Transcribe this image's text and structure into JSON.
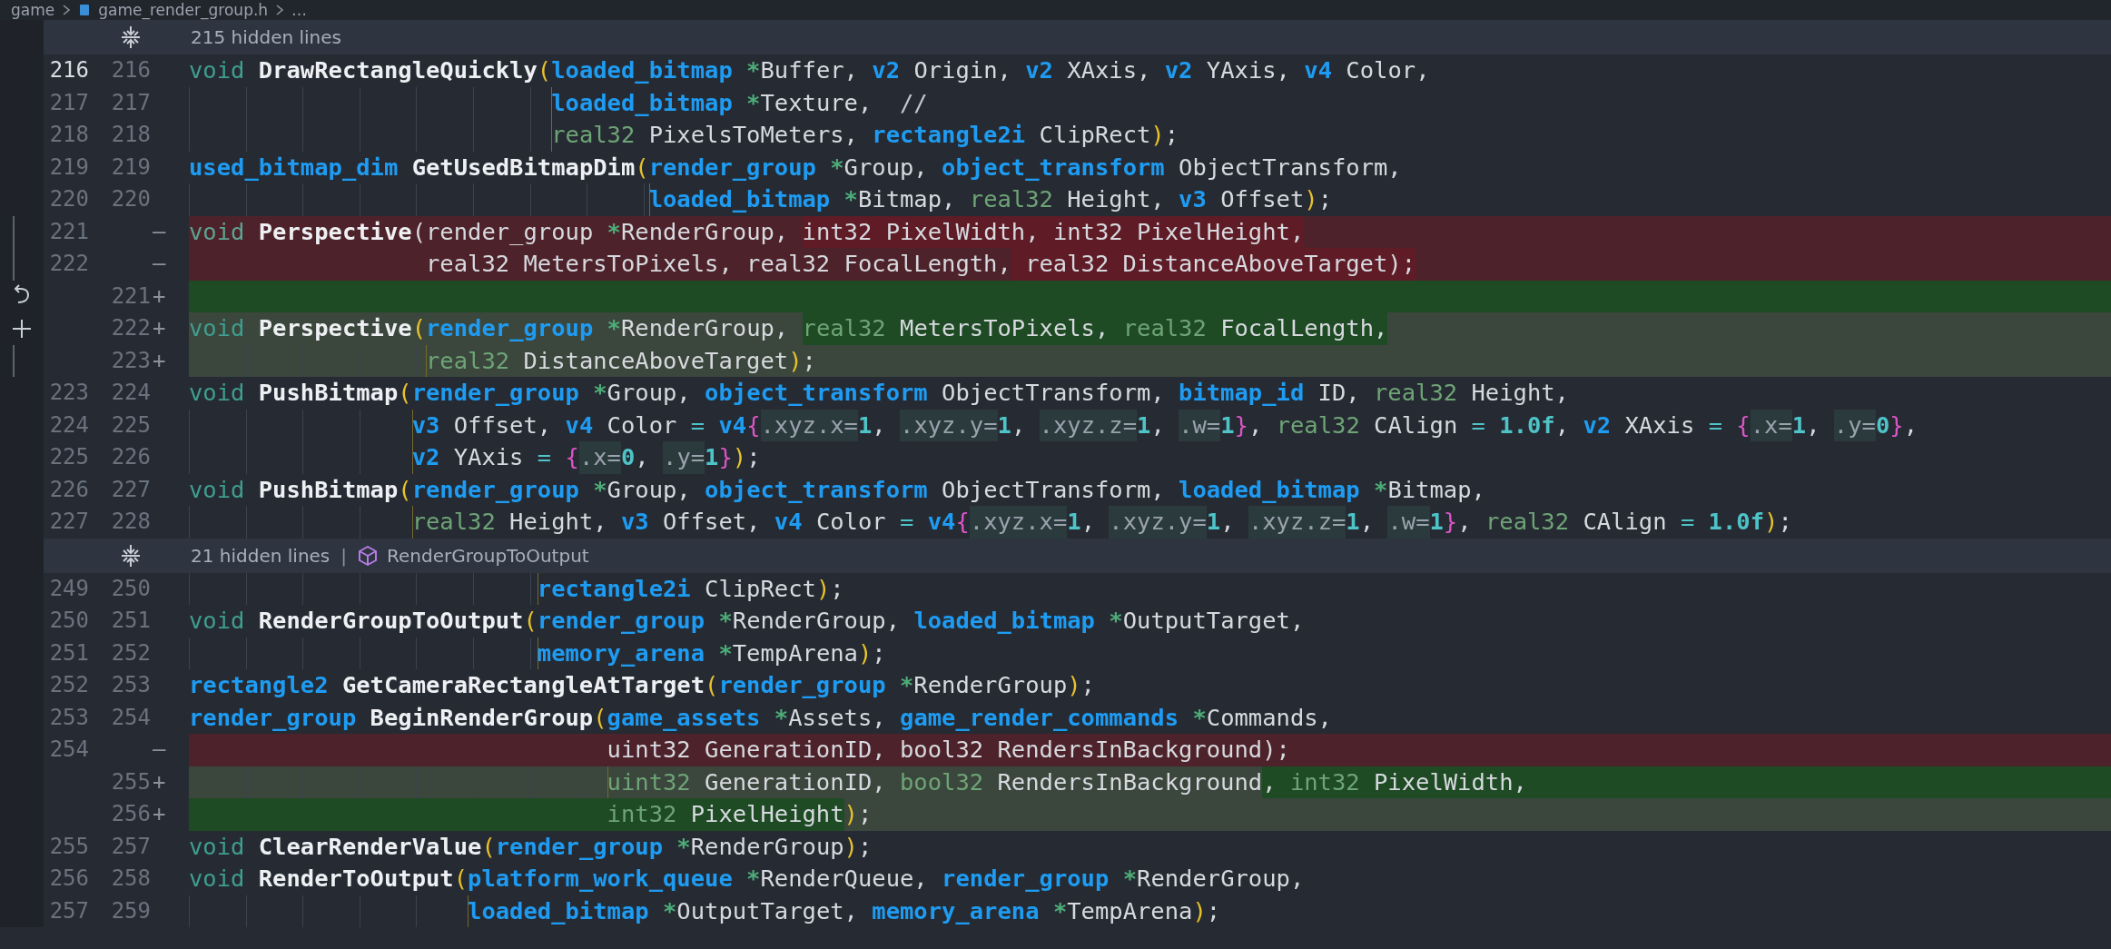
{
  "breadcrumb": [
    {
      "label": "game",
      "kind": "folder"
    },
    {
      "label": "game_render_group.h",
      "kind": "file"
    },
    {
      "label": "…",
      "kind": "more"
    }
  ],
  "sections": [
    {
      "kind": "hidden",
      "label": "215 hidden lines"
    },
    {
      "kind": "lines",
      "rows": [
        {
          "old": "216",
          "new": "216",
          "kind": "context",
          "current": true,
          "tokens": [
            {
              "kind": "kw",
              "text": "void "
            },
            {
              "kind": "fn",
              "text": "DrawRectangleQuickly"
            },
            {
              "kind": "paren",
              "text": "("
            },
            {
              "kind": "type",
              "text": "loaded_bitmap"
            },
            {
              "kind": "star",
              "text": " *"
            },
            {
              "kind": "id",
              "text": "Buffer, "
            },
            {
              "kind": "type",
              "text": "v2"
            },
            {
              "kind": "id",
              "text": " Origin, "
            },
            {
              "kind": "type",
              "text": "v2"
            },
            {
              "kind": "id",
              "text": " XAxis, "
            },
            {
              "kind": "type",
              "text": "v2"
            },
            {
              "kind": "id",
              "text": " YAxis, "
            },
            {
              "kind": "type",
              "text": "v4"
            },
            {
              "kind": "id",
              "text": " Color,"
            }
          ]
        },
        {
          "old": "217",
          "new": "217",
          "kind": "context",
          "current": false,
          "tokens": [
            {
              "kind": "type",
              "text": "                          loaded_bitmap"
            },
            {
              "kind": "star",
              "text": " *"
            },
            {
              "kind": "id",
              "text": "Texture,  "
            },
            {
              "kind": "com",
              "text": "//"
            }
          ]
        },
        {
          "old": "218",
          "new": "218",
          "kind": "context",
          "current": false,
          "tokens": [
            {
              "kind": "prim",
              "text": "                          real32"
            },
            {
              "kind": "id",
              "text": " PixelsToMeters, "
            },
            {
              "kind": "type",
              "text": "rectangle2i"
            },
            {
              "kind": "id",
              "text": " ClipRect"
            },
            {
              "kind": "paren",
              "text": ")"
            },
            {
              "kind": "id",
              "text": ";"
            }
          ]
        },
        {
          "old": "219",
          "new": "219",
          "kind": "context",
          "current": false,
          "tokens": [
            {
              "kind": "type",
              "text": "used_bitmap_dim"
            },
            {
              "kind": "fn",
              "text": " GetUsedBitmapDim"
            },
            {
              "kind": "paren",
              "text": "("
            },
            {
              "kind": "type",
              "text": "render_group"
            },
            {
              "kind": "star",
              "text": " *"
            },
            {
              "kind": "id",
              "text": "Group, "
            },
            {
              "kind": "type",
              "text": "object_transform"
            },
            {
              "kind": "id",
              "text": " ObjectTransform,"
            }
          ]
        },
        {
          "old": "220",
          "new": "220",
          "kind": "context",
          "current": false,
          "tokens": [
            {
              "kind": "type",
              "text": "                                 loaded_bitmap"
            },
            {
              "kind": "star",
              "text": " *"
            },
            {
              "kind": "id",
              "text": "Bitmap, "
            },
            {
              "kind": "prim",
              "text": "real32"
            },
            {
              "kind": "id",
              "text": " Height, "
            },
            {
              "kind": "type",
              "text": "v3"
            },
            {
              "kind": "id",
              "text": " Offset"
            },
            {
              "kind": "paren",
              "text": ")"
            },
            {
              "kind": "id",
              "text": ";"
            }
          ]
        },
        {
          "old": "221",
          "sign": "—",
          "kind": "removed",
          "current": false,
          "gutter": {
            "kind": "bar"
          },
          "tail_highlight": false,
          "tokens": [
            {
              "kind": "kw",
              "text": "void ",
              "changed": false
            },
            {
              "kind": "fn",
              "text": "Perspective",
              "changed": false
            },
            {
              "kind": "id",
              "text": "(render_group",
              "changed": false
            },
            {
              "kind": "star",
              "text": " *",
              "changed": false
            },
            {
              "kind": "id",
              "text": "RenderGroup, ",
              "changed": false
            },
            {
              "kind": "id",
              "text": "int32 PixelWidth, int32 PixelHeight,",
              "changed": true
            }
          ]
        },
        {
          "old": "222",
          "sign": "—",
          "kind": "removed",
          "current": false,
          "gutter": {
            "kind": "bar"
          },
          "tail_highlight": false,
          "tokens": [
            {
              "kind": "id",
              "text": "                 real32 MetersToPixels, real32 FocalLength,",
              "changed": false
            },
            {
              "kind": "id",
              "text": " real32 DistanceAboveTarget);",
              "changed": true
            }
          ]
        },
        {
          "new": "221",
          "sign": "+",
          "kind": "added",
          "current": false,
          "gutter": {
            "kind": "revert"
          },
          "tail_highlight": true
        },
        {
          "new": "222",
          "sign": "+",
          "kind": "added",
          "current": false,
          "gutter": {
            "kind": "add"
          },
          "tail_highlight": false,
          "tokens": [
            {
              "kind": "kw",
              "text": "void ",
              "changed": false
            },
            {
              "kind": "fn",
              "text": "Perspective",
              "changed": false
            },
            {
              "kind": "paren",
              "text": "(",
              "changed": false
            },
            {
              "kind": "type",
              "text": "render_group",
              "changed": false
            },
            {
              "kind": "star",
              "text": " *",
              "changed": false
            },
            {
              "kind": "id",
              "text": "RenderGroup, ",
              "changed": false
            },
            {
              "kind": "prim",
              "text": "real32",
              "changed": true
            },
            {
              "kind": "id",
              "text": " MetersToPixels, ",
              "changed": true
            },
            {
              "kind": "prim",
              "text": "real32",
              "changed": true
            },
            {
              "kind": "id",
              "text": " FocalLength,",
              "changed": true
            }
          ]
        },
        {
          "new": "223",
          "sign": "+",
          "kind": "added",
          "current": false,
          "gutter": {
            "kind": "bar"
          },
          "tail_highlight": false,
          "tokens": [
            {
              "kind": "prim",
              "text": "                 real32",
              "changed": false
            },
            {
              "kind": "id",
              "text": " DistanceAboveTarget",
              "changed": false
            },
            {
              "kind": "paren",
              "text": ")",
              "changed": false
            },
            {
              "kind": "id",
              "text": ";",
              "changed": false
            }
          ]
        },
        {
          "old": "223",
          "new": "224",
          "kind": "context",
          "current": false,
          "tokens": [
            {
              "kind": "kw",
              "text": "void "
            },
            {
              "kind": "fn",
              "text": "PushBitmap"
            },
            {
              "kind": "paren",
              "text": "("
            },
            {
              "kind": "type",
              "text": "render_group"
            },
            {
              "kind": "star",
              "text": " *"
            },
            {
              "kind": "id",
              "text": "Group, "
            },
            {
              "kind": "type",
              "text": "object_transform"
            },
            {
              "kind": "id",
              "text": " ObjectTransform, "
            },
            {
              "kind": "type",
              "text": "bitmap_id"
            },
            {
              "kind": "id",
              "text": " ID, "
            },
            {
              "kind": "prim",
              "text": "real32"
            },
            {
              "kind": "id",
              "text": " Height,"
            }
          ]
        },
        {
          "old": "224",
          "new": "225",
          "kind": "context",
          "current": false,
          "tokens": [
            {
              "kind": "type",
              "text": "                v3"
            },
            {
              "kind": "id",
              "text": " Offset, "
            },
            {
              "kind": "type",
              "text": "v4"
            },
            {
              "kind": "id",
              "text": " Color "
            },
            {
              "kind": "op",
              "text": "="
            },
            {
              "kind": "type",
              "text": " v4"
            },
            {
              "kind": "brace",
              "text": "{"
            },
            {
              "kind": "field",
              "text": ".xyz.x="
            },
            {
              "kind": "num",
              "text": "1"
            },
            {
              "kind": "id",
              "text": ", "
            },
            {
              "kind": "field",
              "text": ".xyz.y="
            },
            {
              "kind": "num",
              "text": "1"
            },
            {
              "kind": "id",
              "text": ", "
            },
            {
              "kind": "field",
              "text": ".xyz.z="
            },
            {
              "kind": "num",
              "text": "1"
            },
            {
              "kind": "id",
              "text": ", "
            },
            {
              "kind": "field",
              "text": ".w="
            },
            {
              "kind": "num",
              "text": "1"
            },
            {
              "kind": "brace",
              "text": "}"
            },
            {
              "kind": "id",
              "text": ", "
            },
            {
              "kind": "prim",
              "text": "real32"
            },
            {
              "kind": "id",
              "text": " CAlign "
            },
            {
              "kind": "op",
              "text": "="
            },
            {
              "kind": "num",
              "text": " 1.0f"
            },
            {
              "kind": "id",
              "text": ", "
            },
            {
              "kind": "type",
              "text": "v2"
            },
            {
              "kind": "id",
              "text": " XAxis "
            },
            {
              "kind": "op",
              "text": "="
            },
            {
              "kind": "brace",
              "text": " {"
            },
            {
              "kind": "field",
              "text": ".x="
            },
            {
              "kind": "num",
              "text": "1"
            },
            {
              "kind": "id",
              "text": ", "
            },
            {
              "kind": "field",
              "text": ".y="
            },
            {
              "kind": "num",
              "text": "0"
            },
            {
              "kind": "brace",
              "text": "}"
            },
            {
              "kind": "id",
              "text": ","
            }
          ]
        },
        {
          "old": "225",
          "new": "226",
          "kind": "context",
          "current": false,
          "tokens": [
            {
              "kind": "type",
              "text": "                v2"
            },
            {
              "kind": "id",
              "text": " YAxis "
            },
            {
              "kind": "op",
              "text": "="
            },
            {
              "kind": "brace",
              "text": " {"
            },
            {
              "kind": "field",
              "text": ".x="
            },
            {
              "kind": "num",
              "text": "0"
            },
            {
              "kind": "id",
              "text": ", "
            },
            {
              "kind": "field",
              "text": ".y="
            },
            {
              "kind": "num",
              "text": "1"
            },
            {
              "kind": "brace",
              "text": "}"
            },
            {
              "kind": "paren",
              "text": ")"
            },
            {
              "kind": "id",
              "text": ";"
            }
          ]
        },
        {
          "old": "226",
          "new": "227",
          "kind": "context",
          "current": false,
          "tokens": [
            {
              "kind": "kw",
              "text": "void "
            },
            {
              "kind": "fn",
              "text": "PushBitmap"
            },
            {
              "kind": "paren",
              "text": "("
            },
            {
              "kind": "type",
              "text": "render_group"
            },
            {
              "kind": "star",
              "text": " *"
            },
            {
              "kind": "id",
              "text": "Group, "
            },
            {
              "kind": "type",
              "text": "object_transform"
            },
            {
              "kind": "id",
              "text": " ObjectTransform, "
            },
            {
              "kind": "type",
              "text": "loaded_bitmap"
            },
            {
              "kind": "star",
              "text": " *"
            },
            {
              "kind": "id",
              "text": "Bitmap,"
            }
          ]
        },
        {
          "old": "227",
          "new": "228",
          "kind": "context",
          "current": false,
          "tokens": [
            {
              "kind": "prim",
              "text": "                real32"
            },
            {
              "kind": "id",
              "text": " Height, "
            },
            {
              "kind": "type",
              "text": "v3"
            },
            {
              "kind": "id",
              "text": " Offset, "
            },
            {
              "kind": "type",
              "text": "v4"
            },
            {
              "kind": "id",
              "text": " Color "
            },
            {
              "kind": "op",
              "text": "="
            },
            {
              "kind": "type",
              "text": " v4"
            },
            {
              "kind": "brace",
              "text": "{"
            },
            {
              "kind": "field",
              "text": ".xyz.x="
            },
            {
              "kind": "num",
              "text": "1"
            },
            {
              "kind": "id",
              "text": ", "
            },
            {
              "kind": "field",
              "text": ".xyz.y="
            },
            {
              "kind": "num",
              "text": "1"
            },
            {
              "kind": "id",
              "text": ", "
            },
            {
              "kind": "field",
              "text": ".xyz.z="
            },
            {
              "kind": "num",
              "text": "1"
            },
            {
              "kind": "id",
              "text": ", "
            },
            {
              "kind": "field",
              "text": ".w="
            },
            {
              "kind": "num",
              "text": "1"
            },
            {
              "kind": "brace",
              "text": "}"
            },
            {
              "kind": "id",
              "text": ", "
            },
            {
              "kind": "prim",
              "text": "real32"
            },
            {
              "kind": "id",
              "text": " CAlign "
            },
            {
              "kind": "op",
              "text": "="
            },
            {
              "kind": "num",
              "text": " 1.0f"
            },
            {
              "kind": "paren",
              "text": ")"
            },
            {
              "kind": "id",
              "text": ";"
            }
          ]
        }
      ]
    },
    {
      "kind": "hidden",
      "label": "21 hidden lines",
      "separator": "|",
      "symbol": "RenderGroupToOutput"
    },
    {
      "kind": "lines",
      "rows": [
        {
          "old": "249",
          "new": "250",
          "kind": "context",
          "current": false,
          "tokens": [
            {
              "kind": "type",
              "text": "                         rectangle2i"
            },
            {
              "kind": "id",
              "text": " ClipRect"
            },
            {
              "kind": "paren",
              "text": ")"
            },
            {
              "kind": "id",
              "text": ";"
            }
          ]
        },
        {
          "old": "250",
          "new": "251",
          "kind": "context",
          "current": false,
          "tokens": [
            {
              "kind": "kw",
              "text": "void "
            },
            {
              "kind": "fn",
              "text": "RenderGroupToOutput"
            },
            {
              "kind": "paren",
              "text": "("
            },
            {
              "kind": "type",
              "text": "render_group"
            },
            {
              "kind": "star",
              "text": " *"
            },
            {
              "kind": "id",
              "text": "RenderGroup, "
            },
            {
              "kind": "type",
              "text": "loaded_bitmap"
            },
            {
              "kind": "star",
              "text": " *"
            },
            {
              "kind": "id",
              "text": "OutputTarget,"
            }
          ]
        },
        {
          "old": "251",
          "new": "252",
          "kind": "context",
          "current": false,
          "tokens": [
            {
              "kind": "type",
              "text": "                         memory_arena"
            },
            {
              "kind": "star",
              "text": " *"
            },
            {
              "kind": "id",
              "text": "TempArena"
            },
            {
              "kind": "paren",
              "text": ")"
            },
            {
              "kind": "id",
              "text": ";"
            }
          ]
        },
        {
          "old": "252",
          "new": "253",
          "kind": "context",
          "current": false,
          "tokens": [
            {
              "kind": "type",
              "text": "rectangle2"
            },
            {
              "kind": "fn",
              "text": " GetCameraRectangleAtTarget"
            },
            {
              "kind": "paren",
              "text": "("
            },
            {
              "kind": "type",
              "text": "render_group"
            },
            {
              "kind": "star",
              "text": " *"
            },
            {
              "kind": "id",
              "text": "RenderGroup"
            },
            {
              "kind": "paren",
              "text": ")"
            },
            {
              "kind": "id",
              "text": ";"
            }
          ]
        },
        {
          "old": "253",
          "new": "254",
          "kind": "context",
          "current": false,
          "tokens": [
            {
              "kind": "type",
              "text": "render_group"
            },
            {
              "kind": "fn",
              "text": " BeginRenderGroup"
            },
            {
              "kind": "paren",
              "text": "("
            },
            {
              "kind": "type",
              "text": "game_assets"
            },
            {
              "kind": "star",
              "text": " *"
            },
            {
              "kind": "id",
              "text": "Assets, "
            },
            {
              "kind": "type",
              "text": "game_render_commands"
            },
            {
              "kind": "star",
              "text": " *"
            },
            {
              "kind": "id",
              "text": "Commands,"
            }
          ]
        },
        {
          "old": "254",
          "sign": "—",
          "kind": "removed",
          "current": false,
          "tail_highlight": false,
          "tokens": [
            {
              "kind": "id",
              "text": "                              uint32 GenerationID, bool32 RendersInBackground);",
              "changed": false
            }
          ]
        },
        {
          "new": "255",
          "sign": "+",
          "kind": "added",
          "current": false,
          "tail_highlight": true,
          "tokens": [
            {
              "kind": "prim",
              "text": "                              uint32",
              "changed": false
            },
            {
              "kind": "id",
              "text": " GenerationID, ",
              "changed": false
            },
            {
              "kind": "prim",
              "text": "bool32",
              "changed": false
            },
            {
              "kind": "id",
              "text": " RendersInBackground",
              "changed": false
            },
            {
              "kind": "id",
              "text": ", ",
              "changed": true
            },
            {
              "kind": "prim",
              "text": "int32",
              "changed": true
            },
            {
              "kind": "id",
              "text": " PixelWidth,",
              "changed": true
            }
          ]
        },
        {
          "new": "256",
          "sign": "+",
          "kind": "added",
          "current": false,
          "tail_highlight": false,
          "tokens": [
            {
              "kind": "prim",
              "text": "                              int32",
              "changed": true
            },
            {
              "kind": "id",
              "text": " PixelHeight",
              "changed": true
            },
            {
              "kind": "paren",
              "text": ")",
              "changed": false
            },
            {
              "kind": "id",
              "text": ";",
              "changed": false
            }
          ]
        },
        {
          "old": "255",
          "new": "257",
          "kind": "context",
          "current": false,
          "tokens": [
            {
              "kind": "kw",
              "text": "void "
            },
            {
              "kind": "fn",
              "text": "ClearRenderValue"
            },
            {
              "kind": "paren",
              "text": "("
            },
            {
              "kind": "type",
              "text": "render_group"
            },
            {
              "kind": "star",
              "text": " *"
            },
            {
              "kind": "id",
              "text": "RenderGroup"
            },
            {
              "kind": "paren",
              "text": ")"
            },
            {
              "kind": "id",
              "text": ";"
            }
          ]
        },
        {
          "old": "256",
          "new": "258",
          "kind": "context",
          "current": false,
          "tokens": [
            {
              "kind": "kw",
              "text": "void "
            },
            {
              "kind": "fn",
              "text": "RenderToOutput"
            },
            {
              "kind": "paren",
              "text": "("
            },
            {
              "kind": "type",
              "text": "platform_work_queue"
            },
            {
              "kind": "star",
              "text": " *"
            },
            {
              "kind": "id",
              "text": "RenderQueue, "
            },
            {
              "kind": "type",
              "text": "render_group"
            },
            {
              "kind": "star",
              "text": " *"
            },
            {
              "kind": "id",
              "text": "RenderGroup,"
            }
          ]
        },
        {
          "old": "257",
          "new": "259",
          "kind": "context",
          "current": false,
          "tokens": [
            {
              "kind": "type",
              "text": "                    loaded_bitmap"
            },
            {
              "kind": "star",
              "text": " *"
            },
            {
              "kind": "id",
              "text": "OutputTarget, "
            },
            {
              "kind": "type",
              "text": "memory_arena"
            },
            {
              "kind": "star",
              "text": " *"
            },
            {
              "kind": "id",
              "text": "TempArena"
            },
            {
              "kind": "paren",
              "text": ")"
            },
            {
              "kind": "id",
              "text": ";"
            }
          ]
        }
      ]
    }
  ]
}
